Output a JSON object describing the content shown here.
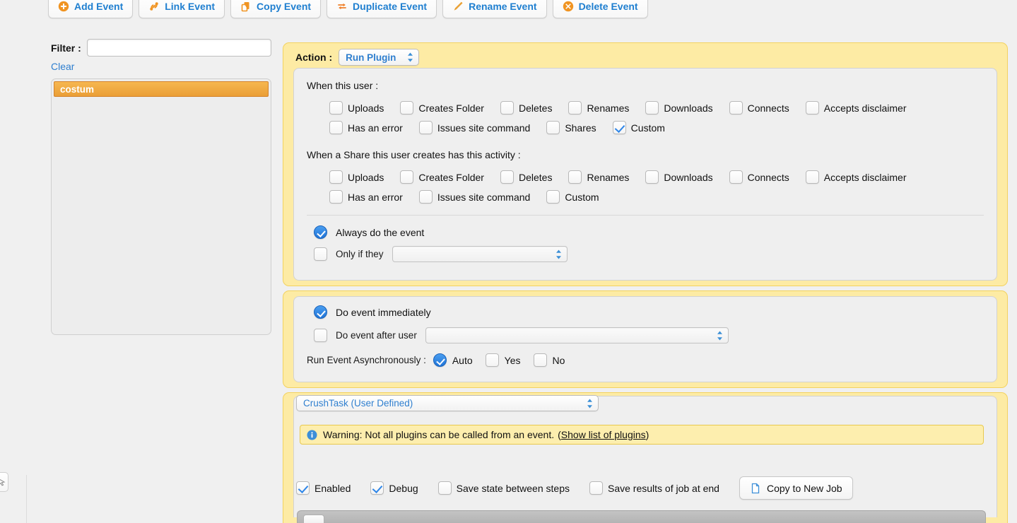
{
  "toolbar": {
    "buttons": [
      {
        "label": "Add Event",
        "icon": "plus-circle-icon"
      },
      {
        "label": "Link Event",
        "icon": "link-icon"
      },
      {
        "label": "Copy Event",
        "icon": "copy-icon"
      },
      {
        "label": "Duplicate Event",
        "icon": "duplicate-arrows-icon"
      },
      {
        "label": "Rename Event",
        "icon": "pencil-icon"
      },
      {
        "label": "Delete Event",
        "icon": "delete-circle-icon"
      }
    ]
  },
  "sidebar": {
    "filter_label": "Filter :",
    "filter_value": "",
    "filter_placeholder": "",
    "clear_label": "Clear",
    "items": [
      {
        "label": "costum",
        "selected": true
      }
    ]
  },
  "action": {
    "label": "Action :",
    "selected": "Run Plugin"
  },
  "trigger_user": {
    "title": "When this user :",
    "row1": [
      {
        "label": "Uploads",
        "checked": false
      },
      {
        "label": "Creates Folder",
        "checked": false
      },
      {
        "label": "Deletes",
        "checked": false
      },
      {
        "label": "Renames",
        "checked": false
      },
      {
        "label": "Downloads",
        "checked": false
      },
      {
        "label": "Connects",
        "checked": false
      },
      {
        "label": "Accepts disclaimer",
        "checked": false
      }
    ],
    "row2": [
      {
        "label": "Has an error",
        "checked": false
      },
      {
        "label": "Issues site command",
        "checked": false
      },
      {
        "label": "Shares",
        "checked": false
      },
      {
        "label": "Custom",
        "checked": true
      }
    ]
  },
  "trigger_share": {
    "title": "When a Share this user creates has this activity :",
    "row1": [
      {
        "label": "Uploads",
        "checked": false
      },
      {
        "label": "Creates Folder",
        "checked": false
      },
      {
        "label": "Deletes",
        "checked": false
      },
      {
        "label": "Renames",
        "checked": false
      },
      {
        "label": "Downloads",
        "checked": false
      },
      {
        "label": "Connects",
        "checked": false
      },
      {
        "label": "Accepts disclaimer",
        "checked": false
      }
    ],
    "row2": [
      {
        "label": "Has an error",
        "checked": false
      },
      {
        "label": "Issues site command",
        "checked": false
      },
      {
        "label": "Custom",
        "checked": false
      }
    ]
  },
  "condition": {
    "always_label": "Always do the event",
    "always_selected": true,
    "only_if_label": "Only if they",
    "only_if_selected": false,
    "only_if_value": ""
  },
  "timing": {
    "immediate_label": "Do event immediately",
    "immediate_selected": true,
    "after_user_label": "Do event after user",
    "after_user_selected": false,
    "after_user_value": "",
    "async_label": "Run Event Asynchronously :",
    "async_options": [
      {
        "label": "Auto",
        "selected": true
      },
      {
        "label": "Yes",
        "selected": false
      },
      {
        "label": "No",
        "selected": false
      }
    ]
  },
  "plugin": {
    "selected": "CrushTask (User Defined)",
    "warning_icon": "info-icon",
    "warning_text": "Warning: Not all plugins can be called from an event.",
    "warning_link_open": "(",
    "warning_link": "Show list of plugins",
    "warning_link_close": ")",
    "options": [
      {
        "label": "Enabled",
        "checked": true
      },
      {
        "label": "Debug",
        "checked": true
      },
      {
        "label": "Save state between steps",
        "checked": false
      },
      {
        "label": "Save results of job at end",
        "checked": false
      }
    ],
    "copy_job_label": "Copy to New Job",
    "copy_job_icon": "document-icon"
  }
}
